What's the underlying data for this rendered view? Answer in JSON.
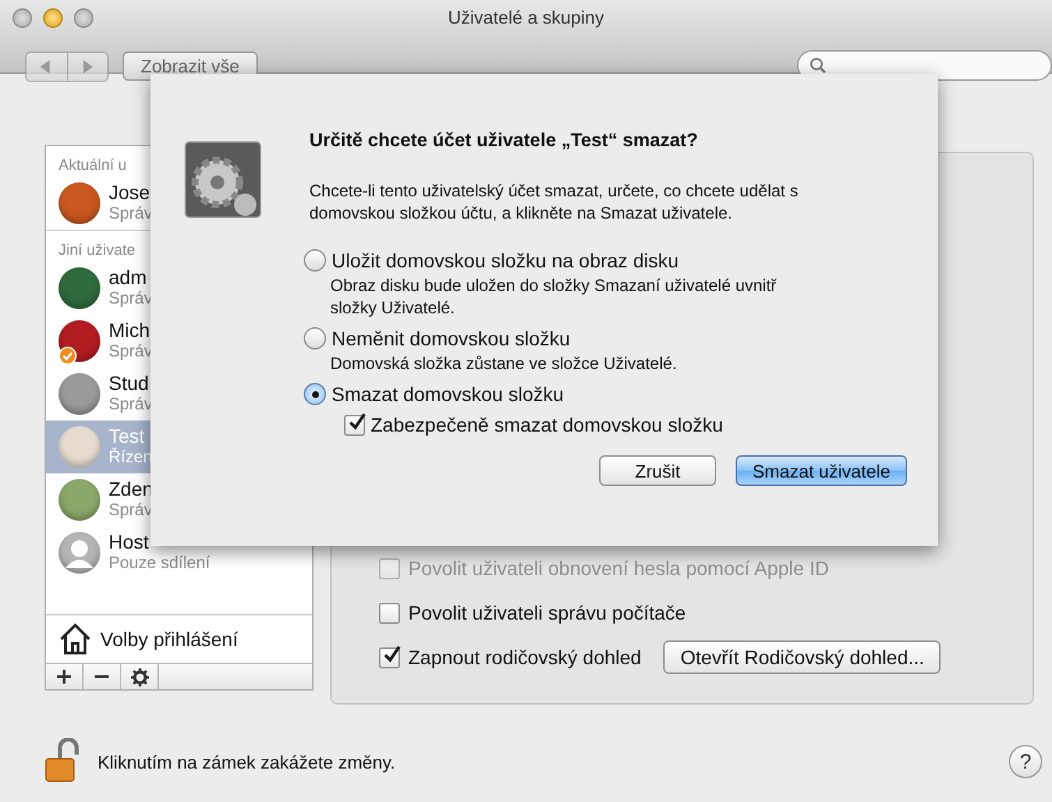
{
  "window": {
    "title": "Uživatelé a skupiny"
  },
  "toolbar": {
    "show_all_button": "Zobrazit vše"
  },
  "sidebar": {
    "sections": [
      {
        "heading": "Aktuální u",
        "users": [
          {
            "name": "Jose",
            "role": "Správ",
            "color": "#c8581f",
            "kind": "user",
            "badge": false,
            "selected": false
          }
        ]
      },
      {
        "heading": "Jiní uživate",
        "users": [
          {
            "name": "adm",
            "role": "Správ",
            "color": "#2f6b3c",
            "kind": "user",
            "badge": false,
            "selected": false
          },
          {
            "name": "Mich",
            "role": "Správ",
            "color": "#b21d22",
            "kind": "user",
            "badge": true,
            "selected": false
          },
          {
            "name": "Stud",
            "role": "Správ",
            "color": "#9a9a9a",
            "kind": "user",
            "badge": false,
            "selected": false
          },
          {
            "name": "Test",
            "role": "Řízen",
            "color": "#e6ddd0",
            "kind": "user",
            "badge": false,
            "selected": true
          },
          {
            "name": "Zden",
            "role": "Správ",
            "color": "#8aa86a",
            "kind": "user",
            "badge": false,
            "selected": false
          },
          {
            "name": "Host",
            "role": "Pouze sdílení",
            "color": "#b5b5b5",
            "kind": "guest",
            "badge": false,
            "selected": false
          }
        ]
      }
    ],
    "login_options": "Volby přihlášení"
  },
  "panel": {
    "options": [
      {
        "label": "Povolit uživateli obnovení hesla pomocí Apple ID",
        "checked": false,
        "disabled": true
      },
      {
        "label": "Povolit uživateli správu počítače",
        "checked": false,
        "disabled": false
      },
      {
        "label": "Zapnout rodičovský dohled",
        "checked": true,
        "disabled": false,
        "button": "Otevřít Rodičovský dohled..."
      }
    ]
  },
  "sheet": {
    "title": "Určitě chcete účet uživatele „Test“ smazat?",
    "message": "Chcete-li tento uživatelský účet smazat, určete, co chcete udělat s domovskou složkou účtu, a klikněte na Smazat uživatele.",
    "choices": [
      {
        "label": "Uložit domovskou složku na obraz disku",
        "description": "Obraz disku bude uložen do složky Smazaní uživatelé uvnitř složky Uživatelé.",
        "selected": false
      },
      {
        "label": "Neměnit domovskou složku",
        "description": "Domovská složka zůstane ve složce Uživatelé.",
        "selected": false
      },
      {
        "label": "Smazat domovskou složku",
        "selected": true,
        "option": {
          "label": "Zabezpečeně smazat domovskou složku",
          "checked": true
        }
      }
    ],
    "buttons": [
      {
        "label": "Zrušit",
        "default": false
      },
      {
        "label": "Smazat uživatele",
        "default": true
      }
    ]
  },
  "footer": {
    "lock_text": "Kliknutím na zámek zakážete změny.",
    "help_button": "?"
  }
}
